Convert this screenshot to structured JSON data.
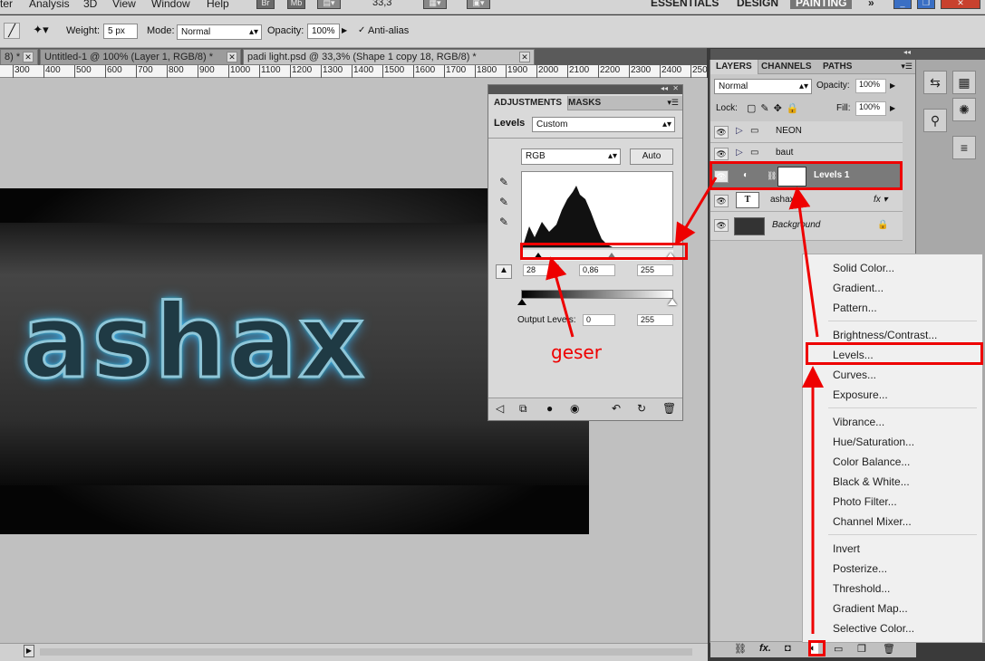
{
  "menubar": {
    "items": [
      "ter",
      "Analysis",
      "3D",
      "View",
      "Window",
      "Help"
    ],
    "bridge": "Br",
    "minibridge": "Mb",
    "zoom": "33,3",
    "workspaces": [
      "ESSENTIALS",
      "DESIGN",
      "PAINTING"
    ]
  },
  "options": {
    "weight_label": "Weight:",
    "weight_value": "5 px",
    "mode_label": "Mode:",
    "mode_value": "Normal",
    "opacity_label": "Opacity:",
    "opacity_value": "100%",
    "antialias_label": "Anti-alias"
  },
  "tabs": [
    {
      "label": "8) *"
    },
    {
      "label": "Untitled-1 @ 100% (Layer 1, RGB/8) *"
    },
    {
      "label": "padi light.psd @ 33,3% (Shape 1 copy 18, RGB/8) *"
    }
  ],
  "ruler": [
    "300",
    "400",
    "500",
    "600",
    "700",
    "800",
    "900",
    "1000",
    "1100",
    "1200",
    "1300",
    "1400",
    "1500",
    "1600",
    "1700",
    "1800",
    "1900",
    "2000",
    "2100",
    "2200",
    "2300",
    "2400",
    "250"
  ],
  "canvas": {
    "art_text": "ashax"
  },
  "adjustments": {
    "tab_active": "ADJUSTMENTS",
    "tab_other": "MASKS",
    "levels_label": "Levels",
    "preset_value": "Custom",
    "channel_value": "RGB",
    "auto_label": "Auto",
    "input_black": "28",
    "input_gamma": "0,86",
    "input_white": "255",
    "output_label": "Output Levels:",
    "output_black": "0",
    "output_white": "255"
  },
  "layers_panel": {
    "tabs": [
      "LAYERS",
      "CHANNELS",
      "PATHS"
    ],
    "blend_value": "Normal",
    "opacity_label": "Opacity:",
    "opacity_value": "100%",
    "lock_label": "Lock:",
    "fill_label": "Fill:",
    "fill_value": "100%",
    "layers": [
      {
        "name": "NEON"
      },
      {
        "name": "baut"
      },
      {
        "name": "Levels 1"
      },
      {
        "name": "ashax"
      },
      {
        "name": "Background"
      }
    ]
  },
  "context_menu": {
    "items": [
      "Solid Color...",
      "Gradient...",
      "Pattern...",
      "Brightness/Contrast...",
      "Levels...",
      "Curves...",
      "Exposure...",
      "Vibrance...",
      "Hue/Saturation...",
      "Color Balance...",
      "Black & White...",
      "Photo Filter...",
      "Channel Mixer...",
      "Invert",
      "Posterize...",
      "Threshold...",
      "Gradient Map...",
      "Selective Color..."
    ]
  },
  "annotation": {
    "geser": "geser"
  },
  "colors": {
    "highlight": "#e00000",
    "glow": "#3fb7ff"
  }
}
